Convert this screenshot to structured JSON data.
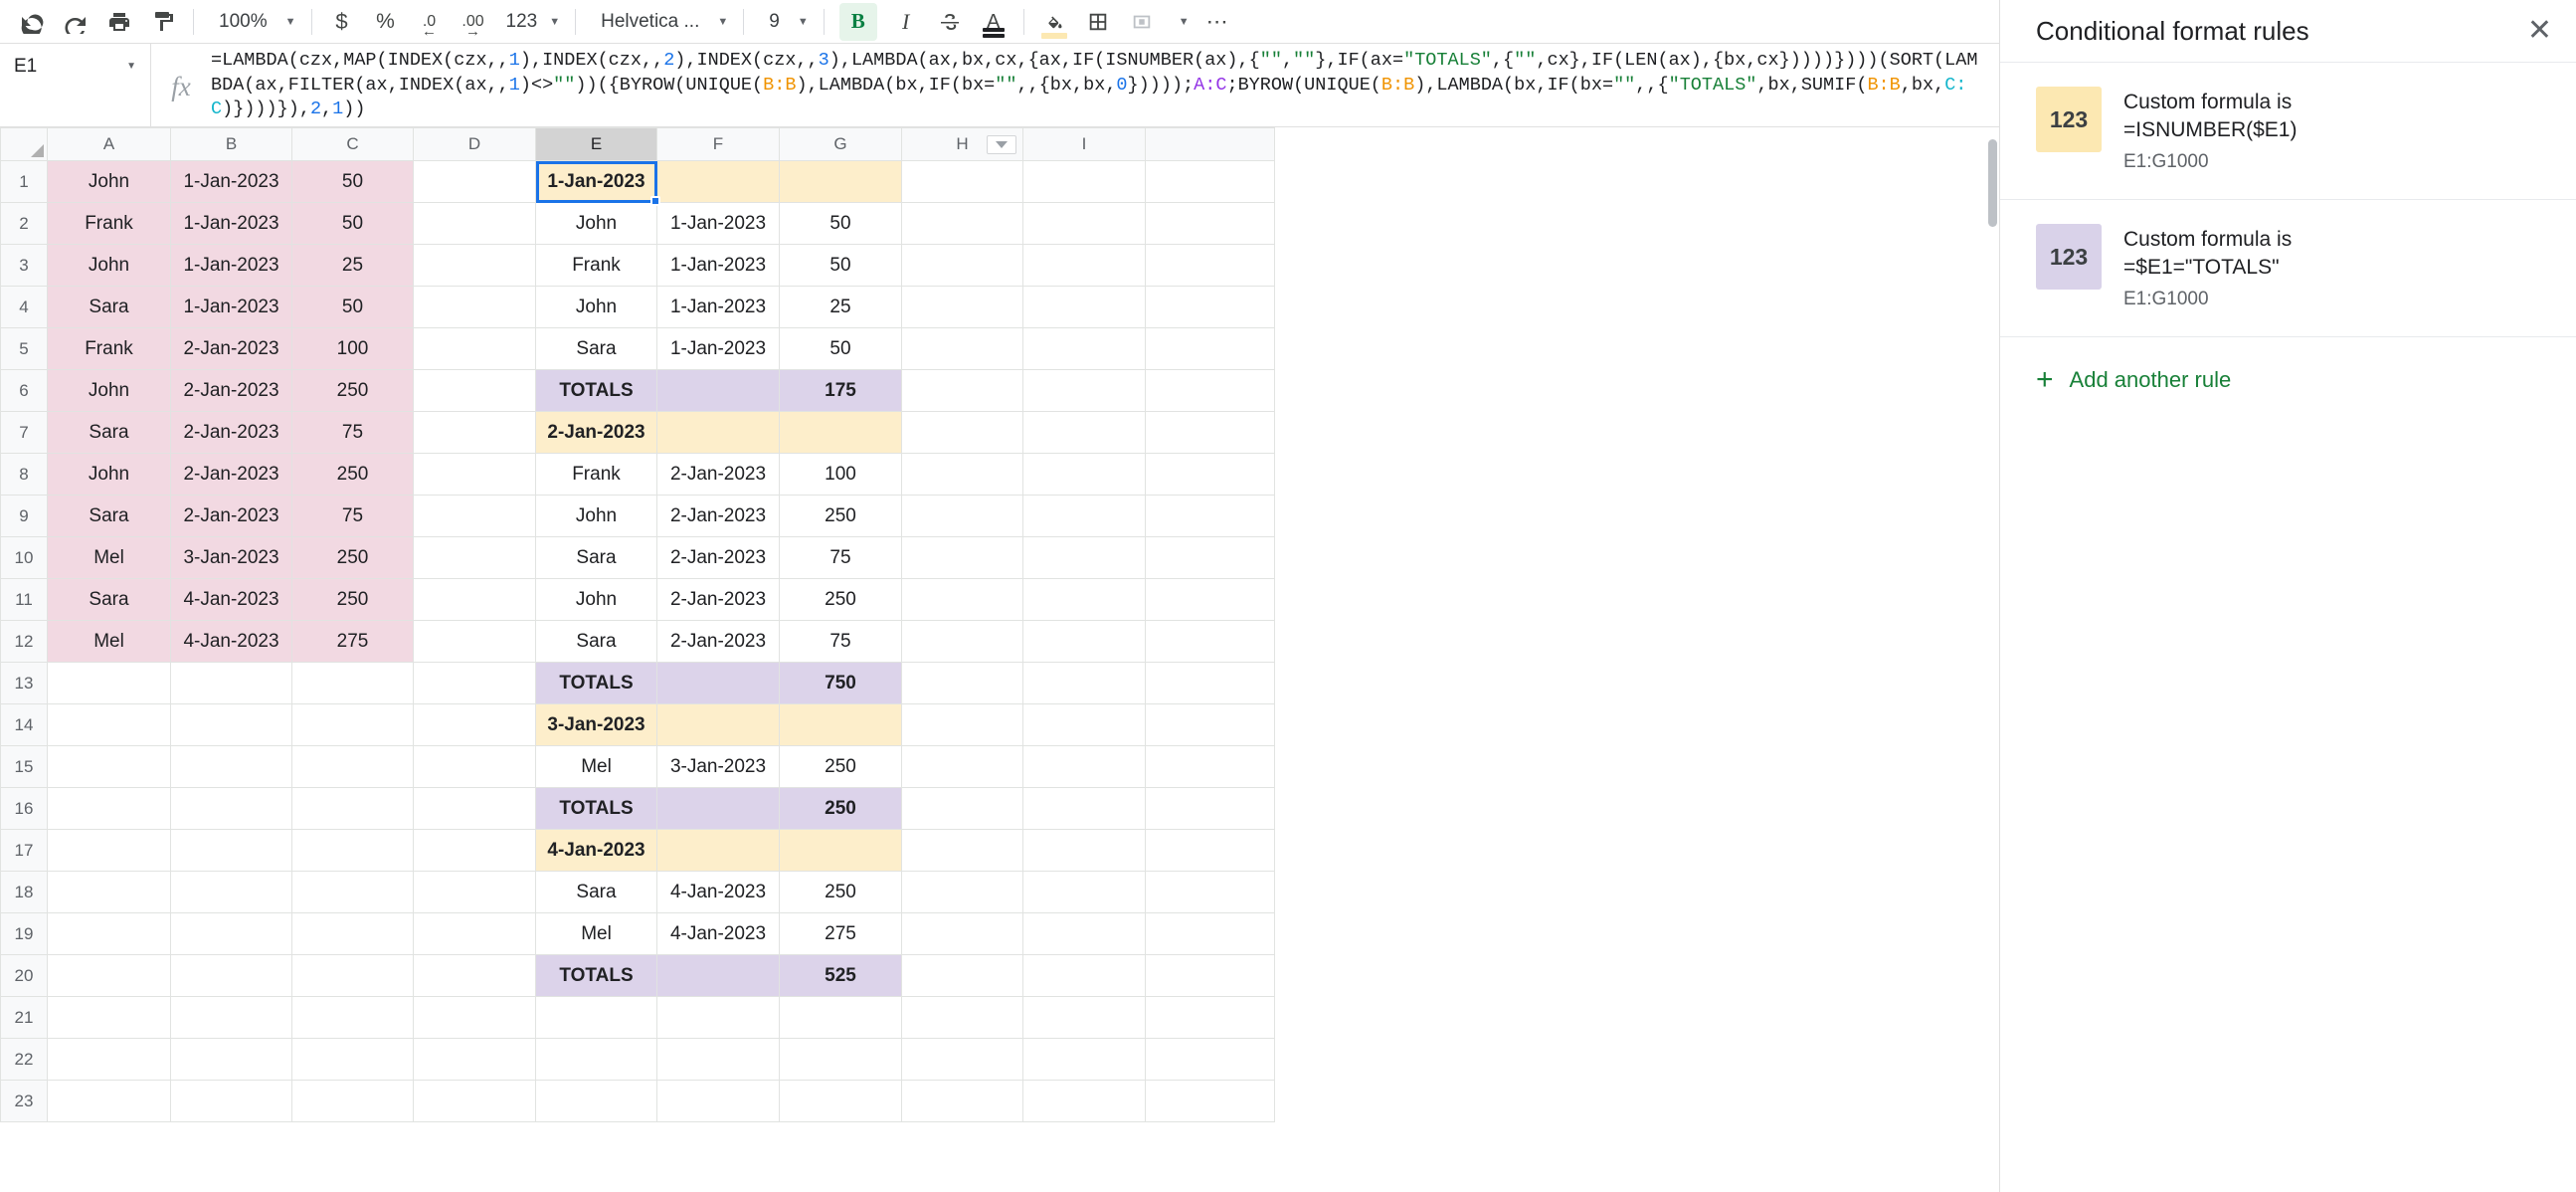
{
  "toolbar": {
    "zoom_label": "100%",
    "currency_icon": "currency-icon",
    "percent_icon": "percent-icon",
    "decrease_decimal_icon": "decrease-decimal-icon",
    "increase_decimal_icon": "increase-decimal-icon",
    "more_formats_label": "123",
    "font_label": "Helvetica ...",
    "font_size_label": "9",
    "bold_label": "B",
    "italic_label": "I",
    "underline_label": "U",
    "fill_color_icon": "fill-color-icon",
    "borders_icon": "borders-icon",
    "merge_cells_icon": "merge-cells-icon",
    "more_icon": "more-options-icon",
    "undo_icon": "undo-icon",
    "redo_icon": "redo-icon",
    "print_icon": "print-icon",
    "paint_format_icon": "paint-format-icon"
  },
  "formula_bar": {
    "name_box_value": "E1",
    "fx_label": "fx",
    "formula_tokens": [
      {
        "t": "=LAMBDA(czx,MAP(INDEX(czx,,",
        "c": ""
      },
      {
        "t": "1",
        "c": "tk-num"
      },
      {
        "t": "),INDEX(czx,,",
        "c": ""
      },
      {
        "t": "2",
        "c": "tk-num"
      },
      {
        "t": "),INDEX(czx,,",
        "c": ""
      },
      {
        "t": "3",
        "c": "tk-num"
      },
      {
        "t": "),LAMBDA(ax,bx,cx,{ax,IF(ISNUMBER(ax),{",
        "c": ""
      },
      {
        "t": "\"\"",
        "c": "tk-str"
      },
      {
        "t": ",",
        "c": ""
      },
      {
        "t": "\"\"",
        "c": "tk-str"
      },
      {
        "t": "},IF(ax=",
        "c": ""
      },
      {
        "t": "\"TOTALS\"",
        "c": "tk-str"
      },
      {
        "t": ",{",
        "c": ""
      },
      {
        "t": "\"\"",
        "c": "tk-str"
      },
      {
        "t": ",cx},IF(LEN(ax),{bx,cx}))))})))(SORT(LAMBDA(ax,FILTER(ax,INDEX(ax,,",
        "c": ""
      },
      {
        "t": "1",
        "c": "tk-num"
      },
      {
        "t": ")<>",
        "c": ""
      },
      {
        "t": "\"\"",
        "c": "tk-str"
      },
      {
        "t": "))({BYROW(UNIQUE(",
        "c": ""
      },
      {
        "t": "B:B",
        "c": "tk-bb"
      },
      {
        "t": "),LAMBDA(bx,IF(bx=",
        "c": ""
      },
      {
        "t": "\"\"",
        "c": "tk-str"
      },
      {
        "t": ",,{bx,bx,",
        "c": ""
      },
      {
        "t": "0",
        "c": "tk-num"
      },
      {
        "t": "}))));",
        "c": ""
      },
      {
        "t": "A:C",
        "c": "tk-ac"
      },
      {
        "t": ";BYROW(UNIQUE(",
        "c": ""
      },
      {
        "t": "B:B",
        "c": "tk-bb"
      },
      {
        "t": "),LAMBDA(bx,IF(bx=",
        "c": ""
      },
      {
        "t": "\"\"",
        "c": "tk-str"
      },
      {
        "t": ",,{",
        "c": ""
      },
      {
        "t": "\"TOTALS\"",
        "c": "tk-str"
      },
      {
        "t": ",bx,SUMIF(",
        "c": ""
      },
      {
        "t": "B:B",
        "c": "tk-bb"
      },
      {
        "t": ",bx,",
        "c": ""
      },
      {
        "t": "C:C",
        "c": "tk-cc"
      },
      {
        "t": ")})))}),",
        "c": ""
      },
      {
        "t": "2",
        "c": "tk-num"
      },
      {
        "t": ",",
        "c": ""
      },
      {
        "t": "1",
        "c": "tk-num"
      },
      {
        "t": "))",
        "c": ""
      }
    ]
  },
  "grid": {
    "column_headers": [
      "A",
      "B",
      "C",
      "D",
      "E",
      "F",
      "G",
      "H",
      "I"
    ],
    "selected_column": "E",
    "filter_column": "H",
    "row_numbers": [
      1,
      2,
      3,
      4,
      5,
      6,
      7,
      8,
      9,
      10,
      11,
      12,
      13,
      14,
      15,
      16,
      17,
      18,
      19,
      20,
      21,
      22,
      23
    ],
    "rows": [
      {
        "n": 1,
        "A": "John",
        "B": "1-Jan-2023",
        "C": "50",
        "D": "",
        "E": "1-Jan-2023",
        "F": "",
        "G": "",
        "H": "",
        "I": "",
        "src_fill": "pink",
        "out_fill": "cream",
        "out_bold": true
      },
      {
        "n": 2,
        "A": "Frank",
        "B": "1-Jan-2023",
        "C": "50",
        "D": "",
        "E": "John",
        "F": "1-Jan-2023",
        "G": "50",
        "H": "",
        "I": "",
        "src_fill": "pink",
        "out_fill": "none",
        "out_bold": false
      },
      {
        "n": 3,
        "A": "John",
        "B": "1-Jan-2023",
        "C": "25",
        "D": "",
        "E": "Frank",
        "F": "1-Jan-2023",
        "G": "50",
        "H": "",
        "I": "",
        "src_fill": "pink",
        "out_fill": "none",
        "out_bold": false
      },
      {
        "n": 4,
        "A": "Sara",
        "B": "1-Jan-2023",
        "C": "50",
        "D": "",
        "E": "John",
        "F": "1-Jan-2023",
        "G": "25",
        "H": "",
        "I": "",
        "src_fill": "pink",
        "out_fill": "none",
        "out_bold": false
      },
      {
        "n": 5,
        "A": "Frank",
        "B": "2-Jan-2023",
        "C": "100",
        "D": "",
        "E": "Sara",
        "F": "1-Jan-2023",
        "G": "50",
        "H": "",
        "I": "",
        "src_fill": "pink",
        "out_fill": "none",
        "out_bold": false
      },
      {
        "n": 6,
        "A": "John",
        "B": "2-Jan-2023",
        "C": "250",
        "D": "",
        "E": "TOTALS",
        "F": "",
        "G": "175",
        "H": "",
        "I": "",
        "src_fill": "pink",
        "out_fill": "lav",
        "out_bold": true
      },
      {
        "n": 7,
        "A": "Sara",
        "B": "2-Jan-2023",
        "C": "75",
        "D": "",
        "E": "2-Jan-2023",
        "F": "",
        "G": "",
        "H": "",
        "I": "",
        "src_fill": "pink",
        "out_fill": "cream",
        "out_bold": true
      },
      {
        "n": 8,
        "A": "John",
        "B": "2-Jan-2023",
        "C": "250",
        "D": "",
        "E": "Frank",
        "F": "2-Jan-2023",
        "G": "100",
        "H": "",
        "I": "",
        "src_fill": "pink",
        "out_fill": "none",
        "out_bold": false
      },
      {
        "n": 9,
        "A": "Sara",
        "B": "2-Jan-2023",
        "C": "75",
        "D": "",
        "E": "John",
        "F": "2-Jan-2023",
        "G": "250",
        "H": "",
        "I": "",
        "src_fill": "pink",
        "out_fill": "none",
        "out_bold": false
      },
      {
        "n": 10,
        "A": "Mel",
        "B": "3-Jan-2023",
        "C": "250",
        "D": "",
        "E": "Sara",
        "F": "2-Jan-2023",
        "G": "75",
        "H": "",
        "I": "",
        "src_fill": "pink",
        "out_fill": "none",
        "out_bold": false
      },
      {
        "n": 11,
        "A": "Sara",
        "B": "4-Jan-2023",
        "C": "250",
        "D": "",
        "E": "John",
        "F": "2-Jan-2023",
        "G": "250",
        "H": "",
        "I": "",
        "src_fill": "pink",
        "out_fill": "none",
        "out_bold": false
      },
      {
        "n": 12,
        "A": "Mel",
        "B": "4-Jan-2023",
        "C": "275",
        "D": "",
        "E": "Sara",
        "F": "2-Jan-2023",
        "G": "75",
        "H": "",
        "I": "",
        "src_fill": "pink",
        "out_fill": "none",
        "out_bold": false
      },
      {
        "n": 13,
        "A": "",
        "B": "",
        "C": "",
        "D": "",
        "E": "TOTALS",
        "F": "",
        "G": "750",
        "H": "",
        "I": "",
        "src_fill": "none",
        "out_fill": "lav",
        "out_bold": true
      },
      {
        "n": 14,
        "A": "",
        "B": "",
        "C": "",
        "D": "",
        "E": "3-Jan-2023",
        "F": "",
        "G": "",
        "H": "",
        "I": "",
        "src_fill": "none",
        "out_fill": "cream",
        "out_bold": true
      },
      {
        "n": 15,
        "A": "",
        "B": "",
        "C": "",
        "D": "",
        "E": "Mel",
        "F": "3-Jan-2023",
        "G": "250",
        "H": "",
        "I": "",
        "src_fill": "none",
        "out_fill": "none",
        "out_bold": false
      },
      {
        "n": 16,
        "A": "",
        "B": "",
        "C": "",
        "D": "",
        "E": "TOTALS",
        "F": "",
        "G": "250",
        "H": "",
        "I": "",
        "src_fill": "none",
        "out_fill": "lav",
        "out_bold": true
      },
      {
        "n": 17,
        "A": "",
        "B": "",
        "C": "",
        "D": "",
        "E": "4-Jan-2023",
        "F": "",
        "G": "",
        "H": "",
        "I": "",
        "src_fill": "none",
        "out_fill": "cream",
        "out_bold": true
      },
      {
        "n": 18,
        "A": "",
        "B": "",
        "C": "",
        "D": "",
        "E": "Sara",
        "F": "4-Jan-2023",
        "G": "250",
        "H": "",
        "I": "",
        "src_fill": "none",
        "out_fill": "none",
        "out_bold": false
      },
      {
        "n": 19,
        "A": "",
        "B": "",
        "C": "",
        "D": "",
        "E": "Mel",
        "F": "4-Jan-2023",
        "G": "275",
        "H": "",
        "I": "",
        "src_fill": "none",
        "out_fill": "none",
        "out_bold": false
      },
      {
        "n": 20,
        "A": "",
        "B": "",
        "C": "",
        "D": "",
        "E": "TOTALS",
        "F": "",
        "G": "525",
        "H": "",
        "I": "",
        "src_fill": "none",
        "out_fill": "lav",
        "out_bold": true
      },
      {
        "n": 21,
        "A": "",
        "B": "",
        "C": "",
        "D": "",
        "E": "",
        "F": "",
        "G": "",
        "H": "",
        "I": "",
        "src_fill": "none",
        "out_fill": "none",
        "out_bold": false
      },
      {
        "n": 22,
        "A": "",
        "B": "",
        "C": "",
        "D": "",
        "E": "",
        "F": "",
        "G": "",
        "H": "",
        "I": "",
        "src_fill": "none",
        "out_fill": "none",
        "out_bold": false
      },
      {
        "n": 23,
        "A": "",
        "B": "",
        "C": "",
        "D": "",
        "E": "",
        "F": "",
        "G": "",
        "H": "",
        "I": "",
        "src_fill": "none",
        "out_fill": "none",
        "out_bold": false
      }
    ]
  },
  "side_panel": {
    "title": "Conditional format rules",
    "close_icon": "close-icon",
    "rules": [
      {
        "swatch_label": "123",
        "swatch_color": "#fce8b2",
        "condition": "Custom formula is",
        "formula": "=ISNUMBER($E1)",
        "range": "E1:G1000"
      },
      {
        "swatch_label": "123",
        "swatch_color": "#d9d2e9",
        "condition": "Custom formula is",
        "formula": "=$E1=\"TOTALS\"",
        "range": "E1:G1000"
      }
    ],
    "add_rule_label": "Add another rule",
    "add_rule_icon": "plus-icon",
    "accent_color": "#188038"
  }
}
